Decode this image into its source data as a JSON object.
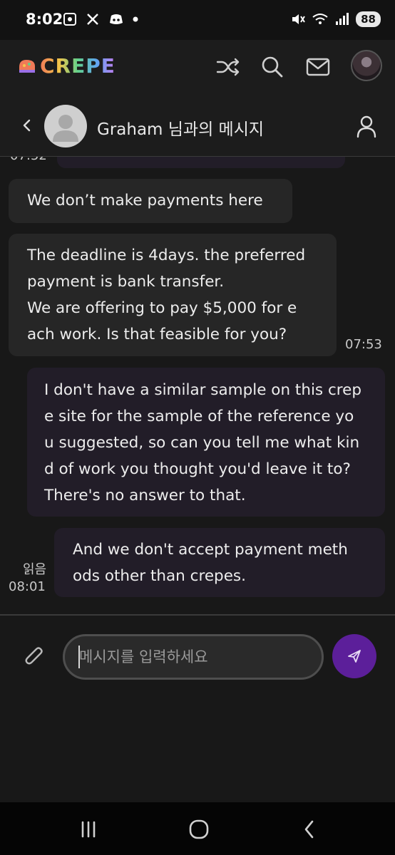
{
  "status": {
    "time": "8:02",
    "battery": "88"
  },
  "app": {
    "logo": "CREPE"
  },
  "chat": {
    "title": "Graham 님과의 메시지"
  },
  "messages": {
    "cut_time": "07:52",
    "m1": "We don’t make payments here",
    "m2": "The deadline is 4days. the preferred\npayment is bank transfer.\nWe are offering to pay $5,000 for e\nach work. Is that feasible for you?",
    "m2_time": "07:53",
    "m3": "I don't have a similar sample on this crep\ne site for the sample of the reference yo\nu suggested, so can you tell me what kin\nd of work you thought you'd leave it to?\nThere's no answer to that.",
    "m4": "And we don't accept payment meth\nods other than crepes.",
    "m4_read": "읽음",
    "m4_time": "08:01"
  },
  "composer": {
    "placeholder": "메시지를 입력하세요"
  }
}
